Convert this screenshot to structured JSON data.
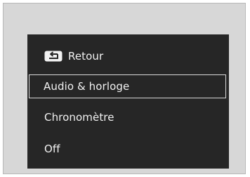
{
  "menu": {
    "back_label": "Retour",
    "items": [
      {
        "label": "Audio & horloge",
        "selected": true
      },
      {
        "label": "Chronomètre",
        "selected": false
      },
      {
        "label": "Off",
        "selected": false
      }
    ]
  },
  "colors": {
    "screen_background": "#262626",
    "text": "#f2f2f2",
    "selection_border": "#d9d9d9",
    "frame_background": "#d7d7d7"
  },
  "icons": {
    "back": "back-arrow-icon"
  }
}
